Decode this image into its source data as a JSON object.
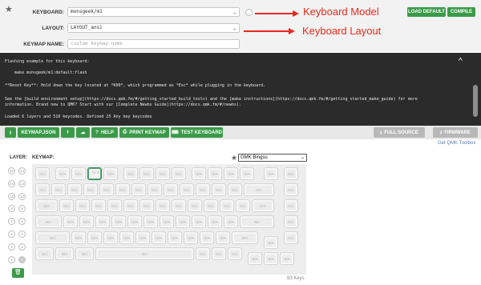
{
  "header": {
    "keyboard_label": "KEYBOARD:",
    "keyboard_value": "monsgeek/m1",
    "layout_label": "LAYOUT:",
    "layout_value": "LAYOUT_ansi",
    "keymap_name_label": "KEYMAP NAME:",
    "keymap_name_placeholder": "custom keymap name",
    "load_default_label": "LOAD DEFAULT",
    "compile_label": "COMPILE"
  },
  "annotations": {
    "model": "Keyboard  Model",
    "layout": "Keyboard Layout"
  },
  "console": {
    "lines": [
      "Flashing example for this keyboard:",
      "    make monsgeek/m1:default:flash",
      "**Reset Key**: Hold down the key located at *K00*, which programmed as *Esc* while plugging in the keyboard.",
      "See the [build environment setup](https://docs.qmk.fm/#/getting_started_build_tools) and the [make instructions](https://docs.qmk.fm/#/getting_started_make_guide) for more",
      "information. Brand new to QMK? Start with our [Complete Newbs Guide](https://docs.qmk.fm/#/newbs).",
      "Loaded 6 layers and 510 keycodes. Defined 25 Any key keycodes"
    ]
  },
  "toolbar": {
    "keymap_json_label": "KEYMAP.JSON",
    "help_label": "HELP",
    "print_keymap_label": "PRINT KEYMAP",
    "test_keyboard_label": "TEST KEYBOARD",
    "full_source_label": "FULL SOURCE",
    "firmware_label": "FIRMWARE",
    "get_toolbox_label": "Get QMK Toolbox"
  },
  "editor": {
    "layer_label": "LAYER:",
    "keymap_label": "KEYMAP:",
    "keycap_theme": "GMK Bingsu",
    "layers": [
      "15",
      "14",
      "13",
      "12",
      "11",
      "10",
      "9",
      "8",
      "7",
      "6",
      "5",
      "4",
      "3",
      "2",
      "1",
      "0"
    ],
    "active_layer": "0",
    "key_legend": "N/A",
    "keys_count": "83 Keys"
  },
  "colors": {
    "accent_green": "#3a9a48",
    "annotation_red": "#e8291c",
    "console_bg": "#2b2b2b"
  }
}
